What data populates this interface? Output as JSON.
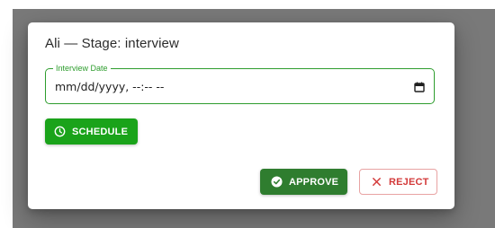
{
  "dialog": {
    "title": "Ali — Stage: interview",
    "field": {
      "label": "Interview Date",
      "value": "mm/dd/yyyy, --:-- --"
    },
    "schedule_label": "SCHEDULE",
    "approve_label": "APPROVE",
    "reject_label": "REJECT"
  },
  "icons": {
    "schedule": "clock-icon",
    "approve": "check-circle-icon",
    "reject": "close-icon",
    "field": "calendar-icon"
  },
  "colors": {
    "primary_green": "#1aa31a",
    "approve_green": "#2f7d2f",
    "field_border": "#2e9d2e",
    "reject_red": "#d33a3a"
  }
}
